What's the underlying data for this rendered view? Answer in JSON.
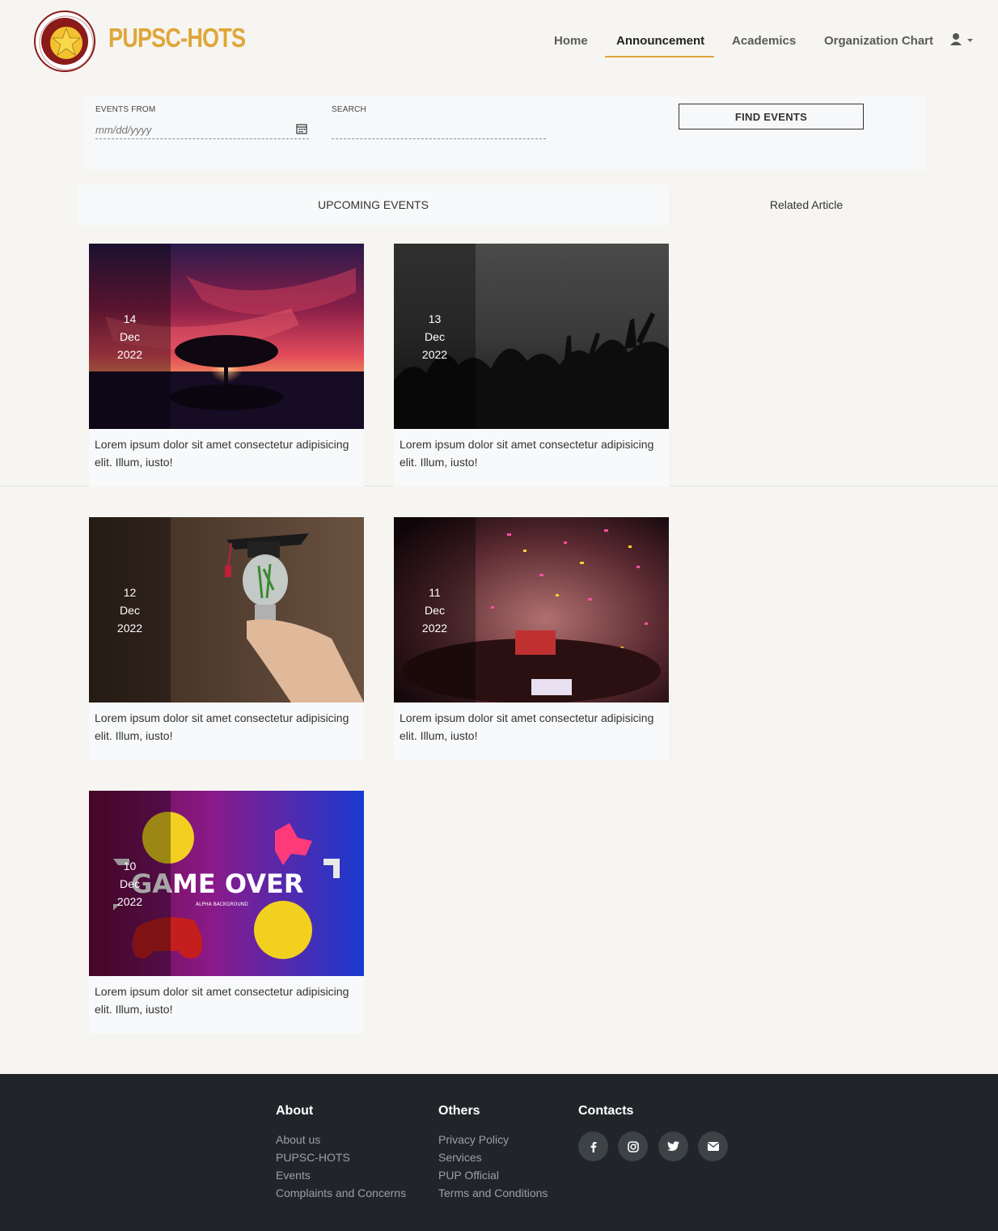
{
  "header": {
    "brand": "PUPSC-HOTS",
    "nav": [
      {
        "label": "Home"
      },
      {
        "label": "Announcement",
        "active": true
      },
      {
        "label": "Academics"
      },
      {
        "label": "Organization Chart"
      }
    ],
    "user_icon": "user-icon",
    "accent_color": "#e0a63a"
  },
  "filter": {
    "events_from_label": "EVENTS FROM",
    "events_from_placeholder": "mm/dd/yyyy",
    "search_label": "SEARCH",
    "search_value": "",
    "find_button": "FIND EVENTS"
  },
  "tabs": {
    "upcoming": "UPCOMING EVENTS",
    "related": "Related Article"
  },
  "events": [
    {
      "day": "14",
      "month": "Dec",
      "year": "2022",
      "desc": "Lorem ipsum dolor sit amet consectetur adipisicing elit. Illum, iusto!",
      "image": "sunset-tree"
    },
    {
      "day": "13",
      "month": "Dec",
      "year": "2022",
      "desc": "Lorem ipsum dolor sit amet consectetur adipisicing elit. Illum, iusto!",
      "image": "concert-crowd"
    },
    {
      "day": "12",
      "month": "Dec",
      "year": "2022",
      "desc": "Lorem ipsum dolor sit amet consectetur adipisicing elit. Illum, iusto!",
      "image": "graduation-bulb"
    },
    {
      "day": "11",
      "month": "Dec",
      "year": "2022",
      "desc": "Lorem ipsum dolor sit amet consectetur adipisicing elit. Illum, iusto!",
      "image": "confetti-party"
    },
    {
      "day": "10",
      "month": "Dec",
      "year": "2022",
      "desc": "Lorem ipsum dolor sit amet consectetur adipisicing elit. Illum, iusto!",
      "image": "game-over",
      "image_text": "GAME OVER",
      "image_subtext": "ALPHA BACKGROUND"
    }
  ],
  "footer": {
    "about": {
      "title": "About",
      "links": [
        "About us",
        "PUPSC-HOTS",
        "Events",
        "Complaints and Concerns"
      ]
    },
    "others": {
      "title": "Others",
      "links": [
        "Privacy Policy",
        "Services",
        "PUP Official",
        "Terms and Conditions"
      ]
    },
    "contacts": {
      "title": "Contacts",
      "icons": [
        "facebook-icon",
        "instagram-icon",
        "twitter-icon",
        "email-icon"
      ]
    }
  }
}
